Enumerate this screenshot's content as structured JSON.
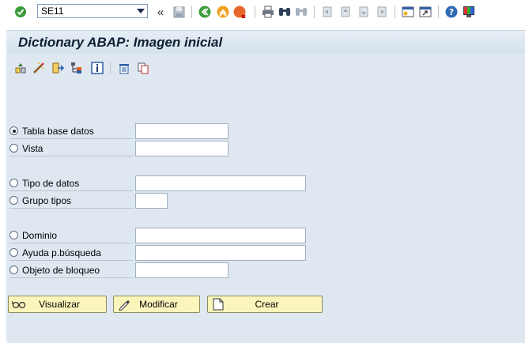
{
  "toolbar": {
    "command_field_value": "SE11",
    "icons": [
      "enter-icon",
      "back-double-icon",
      "save-icon",
      "back-icon",
      "exit-icon",
      "cancel-icon",
      "print-icon",
      "find-icon",
      "find-next-icon",
      "first-page-icon",
      "prev-page-icon",
      "next-page-icon",
      "last-page-icon",
      "new-session-icon",
      "shortcut-icon",
      "help-icon",
      "customize-icon"
    ]
  },
  "screen": {
    "title": "Dictionary ABAP: Imagen inicial"
  },
  "app_toolbar": {
    "icons": [
      "other-object-icon",
      "edit-magic-icon",
      "check-transport-icon",
      "hierarchy-icon",
      "info-icon",
      "delete-icon",
      "copy-icon"
    ]
  },
  "options": [
    {
      "label": "Tabla base datos",
      "selected": true
    },
    {
      "label": "Vista",
      "selected": false
    },
    {
      "label": "Tipo de datos",
      "selected": false
    },
    {
      "label": "Grupo tipos",
      "selected": false
    },
    {
      "label": "Dominio",
      "selected": false
    },
    {
      "label": "Ayuda p.búsqueda",
      "selected": false
    },
    {
      "label": "Objeto de bloqueo",
      "selected": false
    }
  ],
  "buttons": {
    "display": "Visualizar",
    "change": "Modificar",
    "create": "Crear"
  },
  "colors": {
    "background": "#dfe8f0",
    "button_fill": "#fbf5bc",
    "title": "#0d1f33"
  }
}
